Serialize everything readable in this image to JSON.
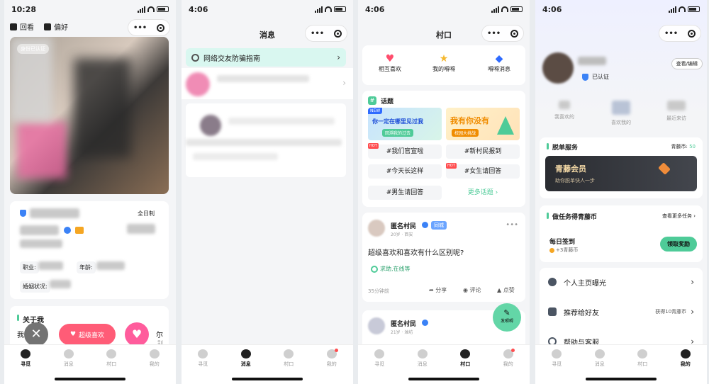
{
  "s1": {
    "time": "10:28",
    "nav_back": "回看",
    "nav_pref": "偏好",
    "verified_badge": "身份已认证",
    "schedule": "全日制",
    "job_label": "职业:",
    "age_label": "年龄:",
    "marital_label": "婚姻状况:",
    "about_title": "关于我",
    "about_text_l": "我",
    "about_text_r": "尔",
    "super_like": "超级喜欢",
    "about_tail1": "(加",
    "about_tail2": "别"
  },
  "s2": {
    "time": "4:06",
    "title": "消息",
    "banner": "网络交友防骗指南"
  },
  "s3": {
    "time": "4:06",
    "title": "村口",
    "q1": "相互喜欢",
    "q2": "我的嘚嘚",
    "q3": "嘚嘚消息",
    "topics_title": "话题",
    "banner1_line1": "你一定在哪里见过我",
    "banner1_line2": "回溯我的过去",
    "banner1_new": "NEW",
    "banner2_line1": "我有你没有",
    "banner2_line2": "校园大挑战",
    "t1": "#我们官宣啦",
    "t2": "#新村民报到",
    "t3": "#今天长这样",
    "t4": "#女生请回答",
    "t5": "#男生请回答",
    "more_topics": "更多话题",
    "hot": "HOT",
    "post_name": "匿名村民",
    "post_city_tag": "同城",
    "post_meta": "20岁 · 西安",
    "post_text": "超级喜欢和喜欢有什么区别呢?",
    "post_tag": "求助,在线等",
    "post_time": "35分钟前",
    "share": "分享",
    "comment": "评论",
    "like": "点赞",
    "post2_name": "匿名村民",
    "post2_meta": "21岁 · 潍坊",
    "fab": "发嘚嘚"
  },
  "s4": {
    "time": "4:06",
    "verified": "已认证",
    "edit": "查看/编辑",
    "stat1": "我喜欢的",
    "stat2": "喜欢我的",
    "stat3": "最近来访",
    "service_title": "脱单服务",
    "coin_label": "青藤币:",
    "coin_value": "50",
    "vip_title": "青藤会员",
    "vip_sub": "助你脱单快人一步",
    "task_title": "做任务得青藤币",
    "task_more": "查看更多任务",
    "checkin": "每日签到",
    "checkin_reward": "+3青藤币",
    "claim": "领取奖励",
    "m1": "个人主页曝光",
    "m2": "推荐给好友",
    "m2_note": "获得10青藤币",
    "m3": "帮助与客服"
  },
  "tabs": {
    "t1": "寻觅",
    "t2": "消息",
    "t3": "村口",
    "t4": "我的"
  },
  "colors": {
    "accent": "#4ecb98",
    "pink": "#ff5c77",
    "blue": "#3b82f6"
  }
}
